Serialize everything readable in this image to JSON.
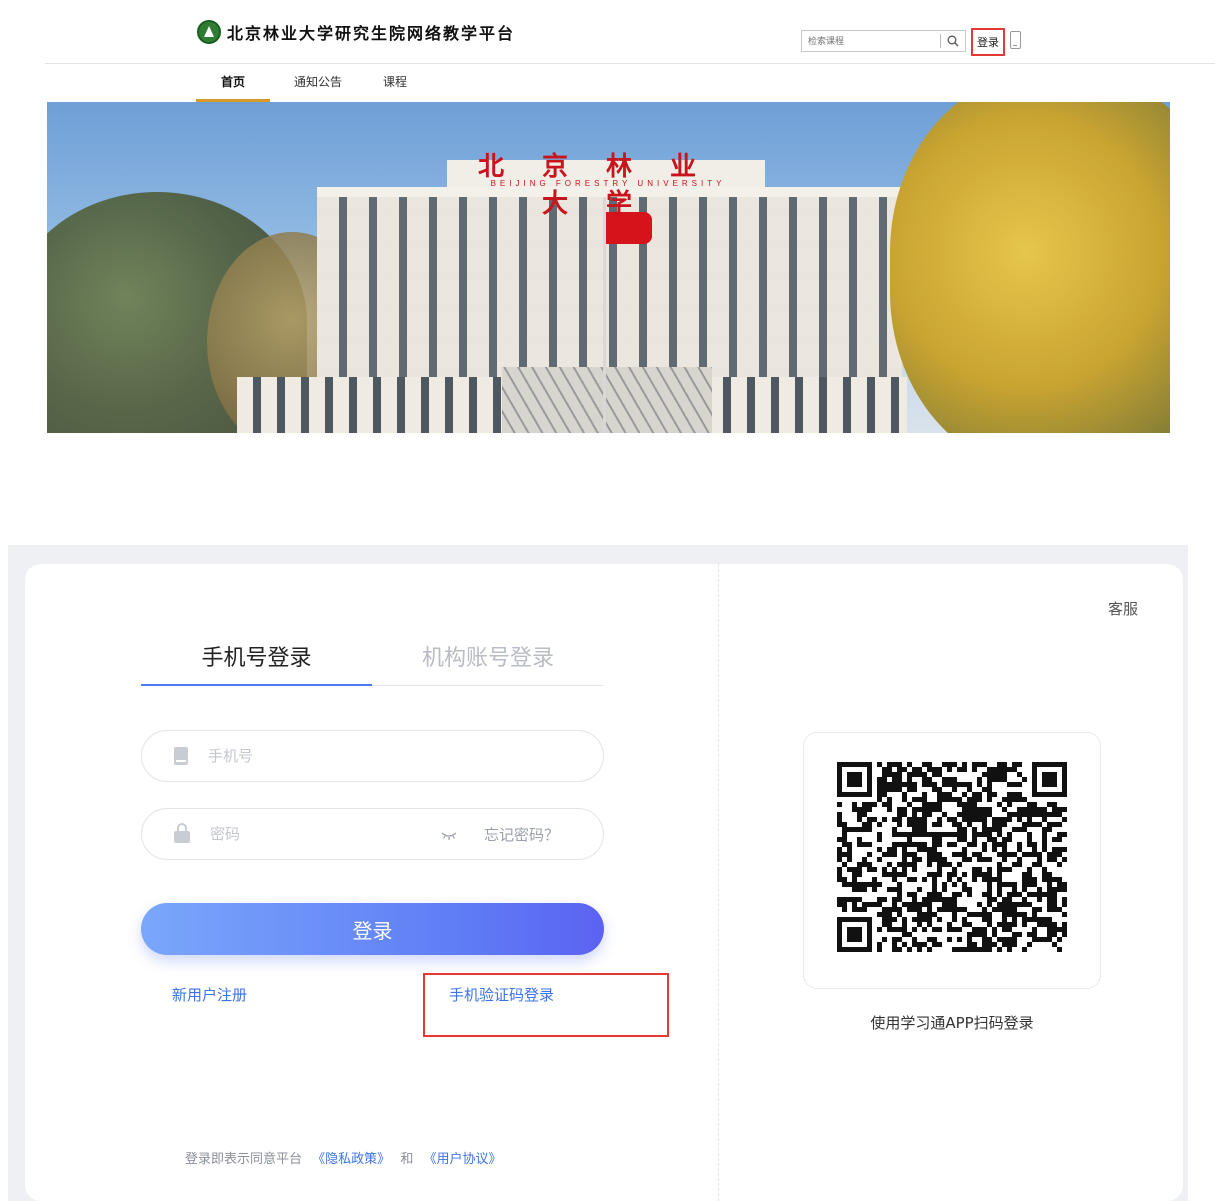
{
  "portal": {
    "site_title": "北京林业大学研究生院网络教学平台",
    "search_placeholder": "检索课程",
    "login_link": "登录",
    "nav": [
      "首页",
      "通知公告",
      "课程"
    ],
    "banner_sign_cn": "北京林业大学",
    "banner_sign_en": "BEIJING FORESTRY UNIVERSITY"
  },
  "login": {
    "tabs": [
      "手机号登录",
      "机构账号登录"
    ],
    "active_tab": 0,
    "phone_placeholder": "手机号",
    "password_placeholder": "密码",
    "forgot_password": "忘记密码？",
    "submit": "登录",
    "register": "新用户注册",
    "sms_login": "手机验证码登录",
    "agreement": {
      "prefix": "登录即表示同意平台",
      "privacy": "《隐私政策》",
      "and": "和",
      "terms": "《用户协议》"
    },
    "customer_service": "客服",
    "qr_tip": "使用学习通APP扫码登录"
  },
  "icons": [
    "search-icon",
    "phone-device-icon",
    "phone-icon",
    "lock-icon",
    "eye-closed-icon",
    "qr-code"
  ],
  "colors": {
    "accent": "#4a7bf0",
    "link": "#3b74e8",
    "highlight_box": "#e53935",
    "nav_underline": "#d99a2b",
    "button_gradient": [
      "#7aa7fb",
      "#5b63f2"
    ]
  }
}
